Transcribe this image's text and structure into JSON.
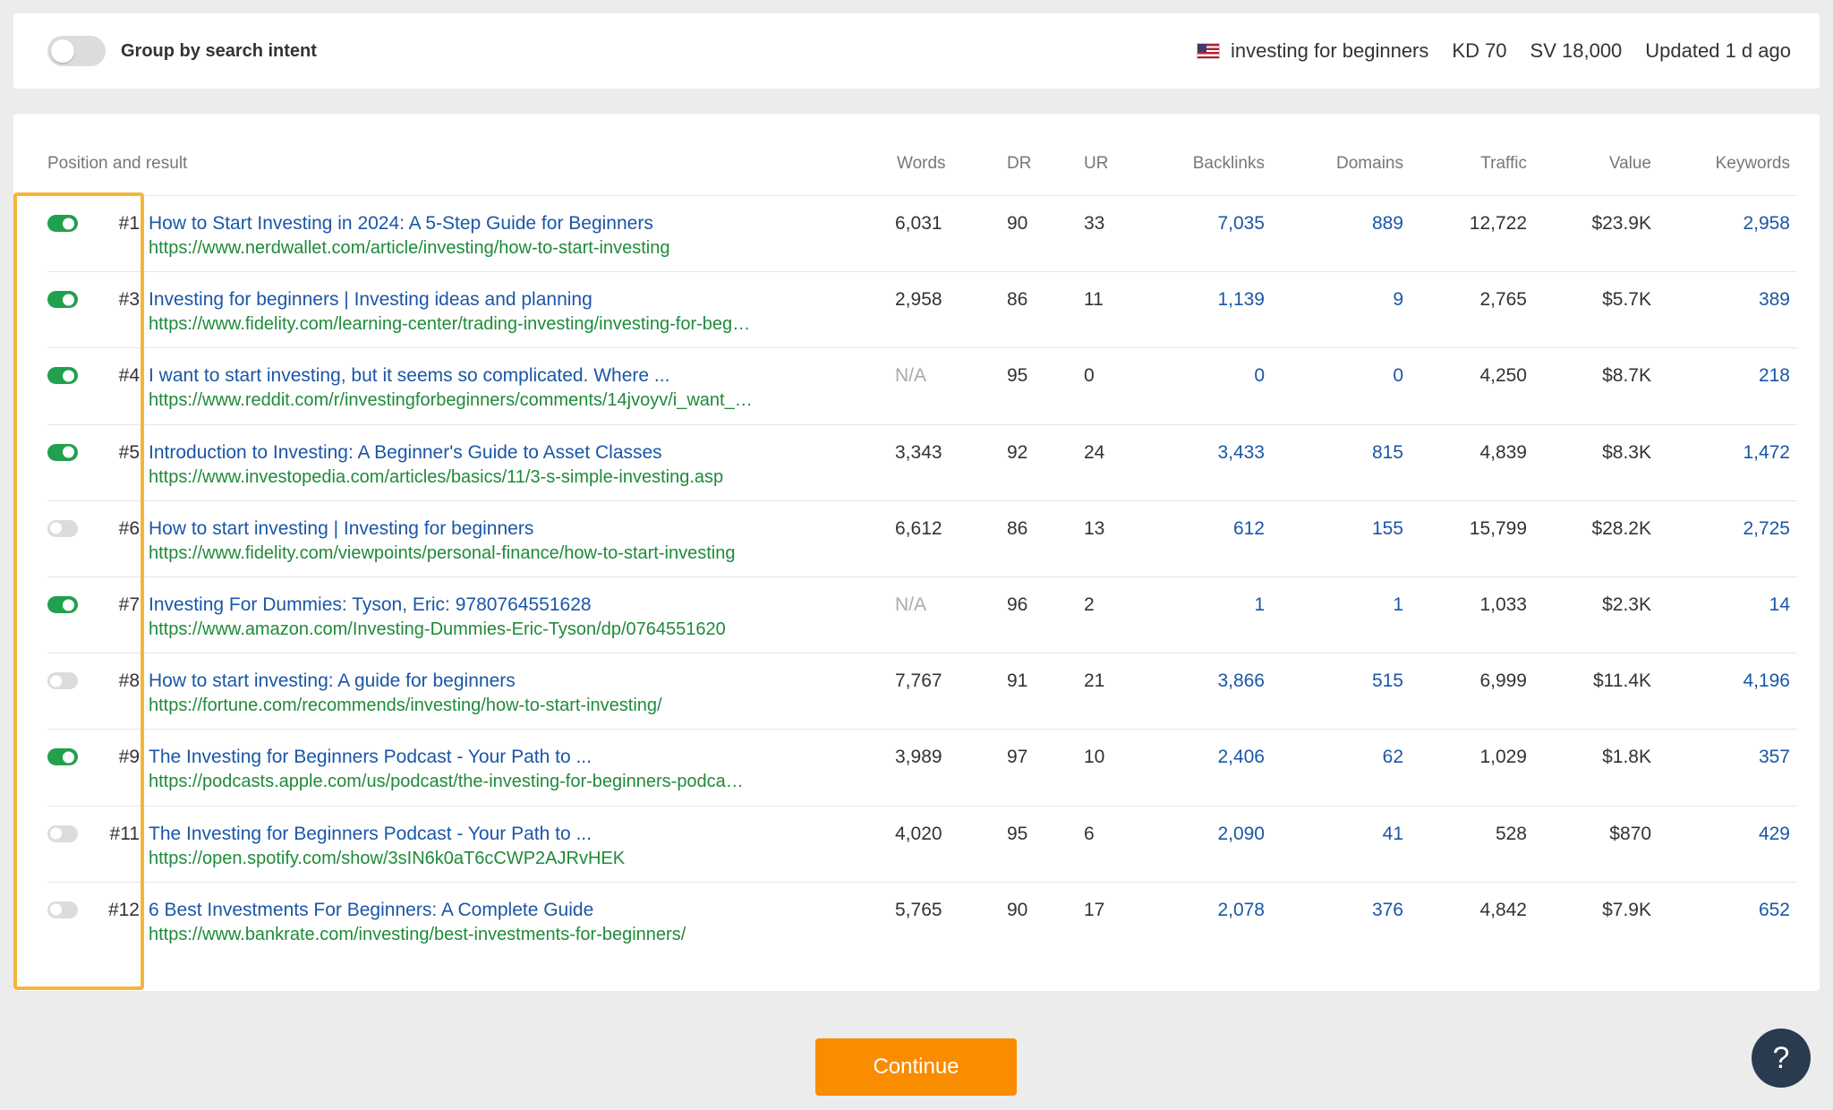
{
  "header": {
    "group_toggle_label": "Group by search intent",
    "group_toggle_on": false,
    "keyword": "investing for beginners",
    "kd": "KD 70",
    "sv": "SV 18,000",
    "updated": "Updated 1 d ago",
    "flag_icon": "us-flag-icon"
  },
  "table": {
    "columns": {
      "position": "Position and result",
      "words": "Words",
      "dr": "DR",
      "ur": "UR",
      "backlinks": "Backlinks",
      "domains": "Domains",
      "traffic": "Traffic",
      "value": "Value",
      "keywords": "Keywords"
    },
    "rows": [
      {
        "on": true,
        "pos": "#1",
        "title": "How to Start Investing in 2024: A 5-Step Guide for Beginners",
        "url": "https://www.nerdwallet.com/article/investing/how-to-start-investing",
        "words": "6,031",
        "dr": "90",
        "ur": "33",
        "backlinks": "7,035",
        "domains": "889",
        "traffic": "12,722",
        "value": "$23.9K",
        "keywords": "2,958"
      },
      {
        "on": true,
        "pos": "#3",
        "title": "Investing for beginners | Investing ideas and planning",
        "url": "https://www.fidelity.com/learning-center/trading-investing/investing-for-beg…",
        "words": "2,958",
        "dr": "86",
        "ur": "11",
        "backlinks": "1,139",
        "domains": "9",
        "traffic": "2,765",
        "value": "$5.7K",
        "keywords": "389"
      },
      {
        "on": true,
        "pos": "#4",
        "title": "I want to start investing, but it seems so complicated. Where ...",
        "url": "https://www.reddit.com/r/investingforbeginners/comments/14jvoyv/i_want_…",
        "words": "N/A",
        "dr": "95",
        "ur": "0",
        "backlinks": "0",
        "domains": "0",
        "traffic": "4,250",
        "value": "$8.7K",
        "keywords": "218"
      },
      {
        "on": true,
        "pos": "#5",
        "title": "Introduction to Investing: A Beginner's Guide to Asset Classes",
        "url": "https://www.investopedia.com/articles/basics/11/3-s-simple-investing.asp",
        "words": "3,343",
        "dr": "92",
        "ur": "24",
        "backlinks": "3,433",
        "domains": "815",
        "traffic": "4,839",
        "value": "$8.3K",
        "keywords": "1,472"
      },
      {
        "on": false,
        "pos": "#6",
        "title": "How to start investing | Investing for beginners",
        "url": "https://www.fidelity.com/viewpoints/personal-finance/how-to-start-investing",
        "words": "6,612",
        "dr": "86",
        "ur": "13",
        "backlinks": "612",
        "domains": "155",
        "traffic": "15,799",
        "value": "$28.2K",
        "keywords": "2,725"
      },
      {
        "on": true,
        "pos": "#7",
        "title": "Investing For Dummies: Tyson, Eric: 9780764551628",
        "url": "https://www.amazon.com/Investing-Dummies-Eric-Tyson/dp/0764551620",
        "words": "N/A",
        "dr": "96",
        "ur": "2",
        "backlinks": "1",
        "domains": "1",
        "traffic": "1,033",
        "value": "$2.3K",
        "keywords": "14"
      },
      {
        "on": false,
        "pos": "#8",
        "title": "How to start investing: A guide for beginners",
        "url": "https://fortune.com/recommends/investing/how-to-start-investing/",
        "words": "7,767",
        "dr": "91",
        "ur": "21",
        "backlinks": "3,866",
        "domains": "515",
        "traffic": "6,999",
        "value": "$11.4K",
        "keywords": "4,196"
      },
      {
        "on": true,
        "pos": "#9",
        "title": "The Investing for Beginners Podcast - Your Path to ...",
        "url": "https://podcasts.apple.com/us/podcast/the-investing-for-beginners-podca…",
        "words": "3,989",
        "dr": "97",
        "ur": "10",
        "backlinks": "2,406",
        "domains": "62",
        "traffic": "1,029",
        "value": "$1.8K",
        "keywords": "357"
      },
      {
        "on": false,
        "pos": "#11",
        "title": "The Investing for Beginners Podcast - Your Path to ...",
        "url": "https://open.spotify.com/show/3sIN6k0aT6cCWP2AJRvHEK",
        "words": "4,020",
        "dr": "95",
        "ur": "6",
        "backlinks": "2,090",
        "domains": "41",
        "traffic": "528",
        "value": "$870",
        "keywords": "429"
      },
      {
        "on": false,
        "pos": "#12",
        "title": "6 Best Investments For Beginners: A Complete Guide",
        "url": "https://www.bankrate.com/investing/best-investments-for-beginners/",
        "words": "5,765",
        "dr": "90",
        "ur": "17",
        "backlinks": "2,078",
        "domains": "376",
        "traffic": "4,842",
        "value": "$7.9K",
        "keywords": "652"
      }
    ]
  },
  "footer": {
    "continue_label": "Continue",
    "help_label": "?"
  },
  "colors": {
    "toggle_on": "#21a04d",
    "link_blue": "#1a56a7",
    "url_green": "#1f8a3a",
    "highlight": "#f4b53b",
    "continue_bg": "#fa8c00"
  }
}
